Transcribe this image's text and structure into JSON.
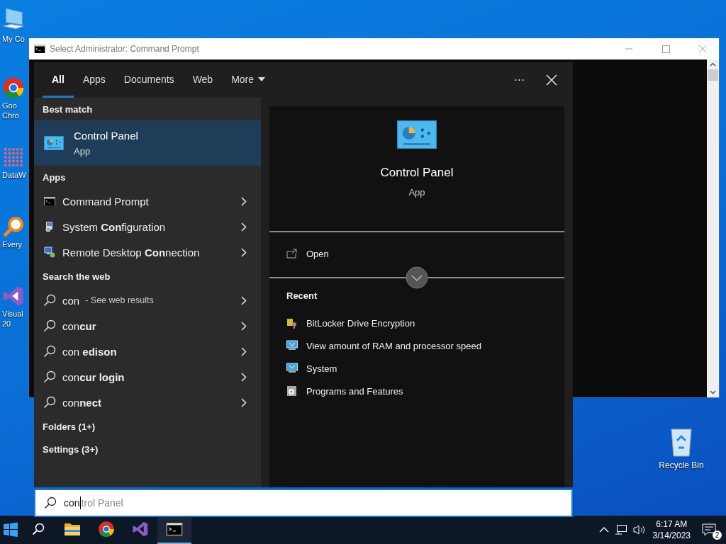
{
  "desktop_icons": [
    {
      "kind": "computer",
      "lines": [
        "My Co"
      ]
    },
    {
      "kind": "browser",
      "lines": [
        "Goo",
        "Chro"
      ]
    },
    {
      "kind": "grid",
      "lines": [
        "DataW"
      ]
    },
    {
      "kind": "magnifier",
      "lines": [
        "Every"
      ]
    },
    {
      "kind": "studio",
      "lines": [
        "Visual",
        "20"
      ]
    }
  ],
  "recycle_bin": {
    "label": "Recycle Bin"
  },
  "cmd_window": {
    "title": "Select Administrator:  Command Prompt"
  },
  "search": {
    "tabs": [
      {
        "kind": "tab",
        "label": "All",
        "selected": true
      },
      {
        "kind": "tab",
        "label": "Apps",
        "selected": false
      },
      {
        "kind": "tab",
        "label": "Documents",
        "selected": false
      },
      {
        "kind": "tab",
        "label": "Web",
        "selected": false
      },
      {
        "kind": "menu",
        "label": "More",
        "selected": false
      }
    ],
    "more_options": "···",
    "best_match": {
      "heading": "Best match",
      "name": "Control Panel",
      "type": "App",
      "selected": true
    },
    "sections": [
      {
        "heading": "Apps",
        "items": [
          {
            "kind": "console",
            "label": "Command Prompt"
          },
          {
            "kind": "config",
            "label": "System **Con**figuration"
          },
          {
            "kind": "remote",
            "label": "Remote Desktop **Con**nection"
          }
        ]
      },
      {
        "heading": "Search the web",
        "items": [
          {
            "kind": "web",
            "label": "con",
            "hint": "- See web results"
          },
          {
            "kind": "web",
            "label": "con**cur**"
          },
          {
            "kind": "web",
            "label": "con **edison**"
          },
          {
            "kind": "web",
            "label": "con**cur login**"
          },
          {
            "kind": "web",
            "label": "con**nect**"
          }
        ]
      }
    ],
    "more_groups": [
      "Folders (1+)",
      "Settings (3+)"
    ],
    "preview": {
      "name": "Control Panel",
      "type": "App",
      "actions": [
        "Open"
      ],
      "recent_heading": "Recent",
      "recent": [
        {
          "kind": "keys",
          "label": "BitLocker Drive Encryption"
        },
        {
          "kind": "monitor",
          "label": "View amount of RAM and processor speed"
        },
        {
          "kind": "monitor",
          "label": "System"
        },
        {
          "kind": "disc",
          "label": "Programs and Features"
        }
      ]
    },
    "query": {
      "value": "con",
      "suggestion": "trol Panel"
    }
  },
  "taskbar": {
    "items": [
      {
        "kind": "search",
        "active": false
      },
      {
        "kind": "folder",
        "active": false
      },
      {
        "kind": "browser",
        "active": false
      },
      {
        "kind": "studio",
        "active": false
      },
      {
        "kind": "console",
        "active": true
      }
    ],
    "time": "6:17 AM",
    "date": "3/14/2023",
    "notifications": "2"
  }
}
